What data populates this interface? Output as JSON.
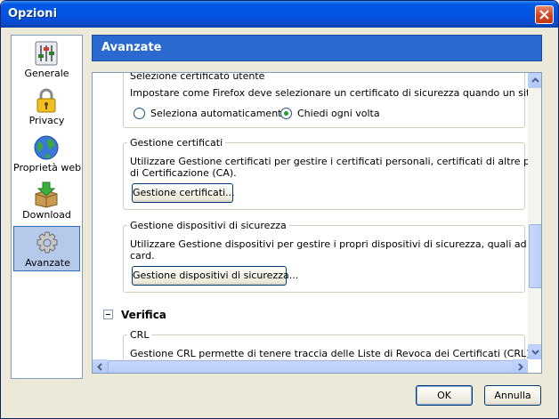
{
  "window": {
    "title": "Opzioni"
  },
  "sidebar": {
    "items": [
      {
        "label": "Generale",
        "icon": "general-icon"
      },
      {
        "label": "Privacy",
        "icon": "lock-icon"
      },
      {
        "label": "Proprietà web",
        "icon": "globe-icon"
      },
      {
        "label": "Download",
        "icon": "download-box-icon"
      },
      {
        "label": "Avanzate",
        "icon": "gear-icon",
        "selected": true
      }
    ]
  },
  "header": {
    "title": "Avanzate"
  },
  "sections": {
    "cert_select": {
      "caption": "Selezione certificato utente",
      "description": "Impostare come Firefox deve selezionare un certificato di sicurezza quando un sito web lo ric",
      "options": [
        "Seleziona automaticamente",
        "Chiedi ogni volta"
      ],
      "selected": "Chiedi ogni volta"
    },
    "cert_manage": {
      "caption": "Gestione certificati",
      "description_line1": "Utilizzare Gestione certificati per gestire i certificati personali, certificati di altre persone e Au",
      "description_line2": "di Certificazione (CA).",
      "button": "Gestione certificati..."
    },
    "device_manage": {
      "caption": "Gestione dispositivi di sicurezza",
      "description_line1": "Utilizzare Gestione dispositivi per gestire i propri dispositivi di sicurezza, quali ad esempio le sm",
      "description_line2": "card.",
      "button": "Gestione dispositivi di sicurezza..."
    },
    "verify": {
      "heading": "Verifica",
      "crl_caption": "CRL",
      "crl_description": "Gestione CRL permette di tenere traccia delle Liste di Revoca dei Certificati (CRL) riguardanti"
    }
  },
  "footer": {
    "ok": "OK",
    "cancel": "Annulla"
  }
}
